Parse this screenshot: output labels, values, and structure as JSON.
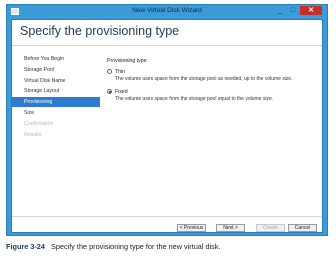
{
  "window": {
    "title": "New Virtual Disk Wizard",
    "close_glyph": "✕",
    "minimize_glyph": "_",
    "maximize_glyph": "□"
  },
  "page": {
    "title": "Specify the provisioning type"
  },
  "nav": {
    "items": [
      {
        "label": "Before You Begin",
        "state": "normal"
      },
      {
        "label": "Storage Pool",
        "state": "normal"
      },
      {
        "label": "Virtual Disk Name",
        "state": "normal"
      },
      {
        "label": "Storage Layout",
        "state": "normal"
      },
      {
        "label": "Provisioning",
        "state": "active"
      },
      {
        "label": "Size",
        "state": "normal"
      },
      {
        "label": "Confirmation",
        "state": "disabled"
      },
      {
        "label": "Results",
        "state": "disabled"
      }
    ]
  },
  "content": {
    "section_label": "Provisioning type:",
    "options": [
      {
        "label": "Thin",
        "description": "The volume uses space from the storage pool as needed, up to the volume size.",
        "selected": false
      },
      {
        "label": "Fixed",
        "description": "The volume uses space from the storage pool equal to the volume size.",
        "selected": true
      }
    ]
  },
  "footer": {
    "previous_label": "< Previous",
    "next_label": "Next >",
    "create_label": "Create",
    "cancel_label": "Cancel"
  },
  "caption": {
    "label": "Figure 3-24",
    "text": "Specify the provisioning type for the new virtual disk."
  },
  "colors": {
    "accent": "#2e7bd0",
    "frame": "#3a9bd8",
    "close": "#c7302a"
  }
}
